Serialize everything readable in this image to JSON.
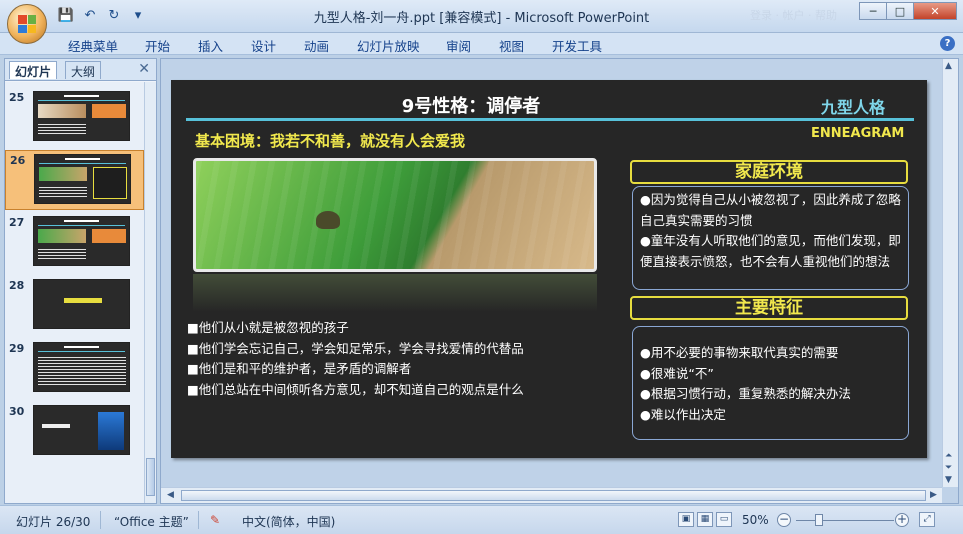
{
  "window": {
    "title": "九型人格-刘一舟.ppt [兼容模式] - Microsoft PowerPoint",
    "faint_text": "登录 · 帐户 · 帮助",
    "min": "─",
    "max": "□",
    "close": "✕"
  },
  "qat": {
    "save": "💾",
    "undo": "↶",
    "redo": "↻",
    "more": "▾"
  },
  "ribbon": {
    "tabs": [
      "经典菜单",
      "开始",
      "插入",
      "设计",
      "动画",
      "幻灯片放映",
      "审阅",
      "视图",
      "开发工具"
    ],
    "help": "?"
  },
  "pane": {
    "tabs": [
      "幻灯片",
      "大纲"
    ],
    "close": "✕",
    "slides": [
      "25",
      "26",
      "27",
      "28",
      "29",
      "30"
    ],
    "active": "26"
  },
  "slide": {
    "title": "9号性格：调停者",
    "brand": "九型人格",
    "subtitle": "基本困境：我若不和善，就没有人会爱我",
    "english": "ENNEAGRAM",
    "bullets": [
      "■他们从小就是被忽视的孩子",
      "■他们学会忘记自己，学会知足常乐，学会寻找爱情的代替品",
      "■他们是和平的维护者，是矛盾的调解者",
      "■他们总站在中间倾听各方意见，却不知道自己的观点是什么"
    ],
    "family_heading": "家庭环境",
    "family": [
      "●因为觉得自己从小被忽视了，因此养成了忽略自己真实需要的习惯",
      "●童年没有人听取他们的意见，而他们发现，即便直接表示愤怒，也不会有人重视他们的想法"
    ],
    "traits_heading": "主要特征",
    "traits": [
      "●用不必要的事物来取代真实的需要",
      "●很难说“不”",
      "●根据习惯行动，重复熟悉的解决办法",
      "●难以作出决定"
    ]
  },
  "status": {
    "slide_count": "幻灯片 26/30",
    "theme": "“Office 主题”",
    "language": "中文(简体，中国)",
    "zoom": "50%",
    "minus": "−",
    "plus": "+"
  },
  "colors": {
    "accent_cyan": "#57c1d9",
    "slide_yellow": "#f1e84d",
    "slide_bg": "#262626"
  }
}
